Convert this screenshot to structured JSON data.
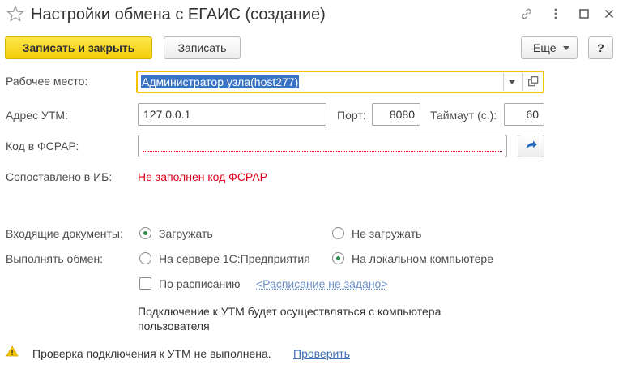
{
  "window": {
    "title": "Настройки обмена с ЕГАИС (создание)"
  },
  "toolbar": {
    "save_close_label": "Записать и закрыть",
    "save_label": "Записать",
    "more_label": "Еще",
    "help_label": "?"
  },
  "form": {
    "workplace": {
      "label": "Рабочее место:",
      "value": "Администратор узла(host277)"
    },
    "utm_address": {
      "label": "Адрес УТМ:",
      "value": "127.0.0.1"
    },
    "port": {
      "label": "Порт:",
      "value": "8080"
    },
    "timeout": {
      "label": "Таймаут (с.):",
      "value": "60"
    },
    "fsrar_code": {
      "label": "Код в ФСРАР:",
      "value": ""
    },
    "matched": {
      "label": "Сопоставлено в ИБ:",
      "value": "Не заполнен код ФСРАР"
    },
    "incoming": {
      "label": "Входящие документы:",
      "options": [
        "Загружать",
        "Не загружать"
      ],
      "selected": "Загружать"
    },
    "exchange": {
      "label": "Выполнять обмен:",
      "options": [
        "На сервере 1С:Предприятия",
        "На локальном компьютере"
      ],
      "selected": "На локальном компьютере"
    },
    "schedule": {
      "checkbox_label": "По расписанию",
      "checked": false,
      "link_label": "<Расписание не задано>"
    },
    "info_text_line1": "Подключение к УТМ будет осуществляться с компьютера",
    "info_text_line2": "пользователя"
  },
  "status": {
    "message": "Проверка подключения к УТМ не выполнена.",
    "check_link": "Проверить"
  },
  "icons": {
    "favorite": "star-icon",
    "link": "link-icon",
    "menu": "kebab-menu-icon",
    "maximize": "maximize-icon",
    "close": "close-icon",
    "warning": "warning-icon",
    "refresh": "refresh-arrow-icon"
  },
  "colors": {
    "primary_button": "#f5cc09",
    "focus_border": "#f5c300",
    "selection": "#3a72c4",
    "error_text": "#e0001b",
    "link": "#3e6fb5",
    "radio_dot": "#2f8f4e"
  }
}
